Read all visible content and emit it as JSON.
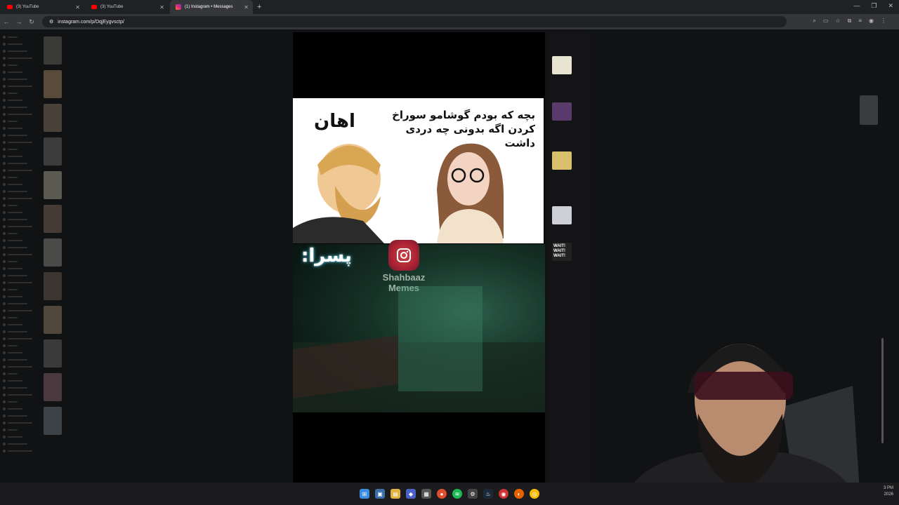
{
  "browser": {
    "tabs": [
      {
        "label": "(3) YouTube",
        "icon": "youtube-icon",
        "active": false
      },
      {
        "label": "(3) YouTube",
        "icon": "youtube-icon",
        "active": false
      },
      {
        "label": "(1) Instagram • Messages",
        "icon": "instagram-icon",
        "active": true
      }
    ],
    "url": "instagram.com/p/DqjEygvsctp/"
  },
  "post": {
    "meme_caption": "بچه که بودم گوشامو سوراخ کردن اگه بدونی چه دردی داشت",
    "meme_reply": "اهان",
    "bottom_caption": "پسرا:",
    "watermark": "Shahbaaz Memes"
  },
  "feed": {
    "thumb_text": "WAIT! WAIT! WAIT!"
  },
  "taskbar": {
    "icons": [
      "windows-icon",
      "explorer-icon",
      "folder-icon",
      "app-icon",
      "store-icon",
      "record-icon",
      "spotify-icon",
      "steam-icon",
      "app-icon",
      "app-icon",
      "firefox-icon",
      "chrome-icon"
    ]
  },
  "clock": {
    "time": "3 PM",
    "date": "2026"
  }
}
